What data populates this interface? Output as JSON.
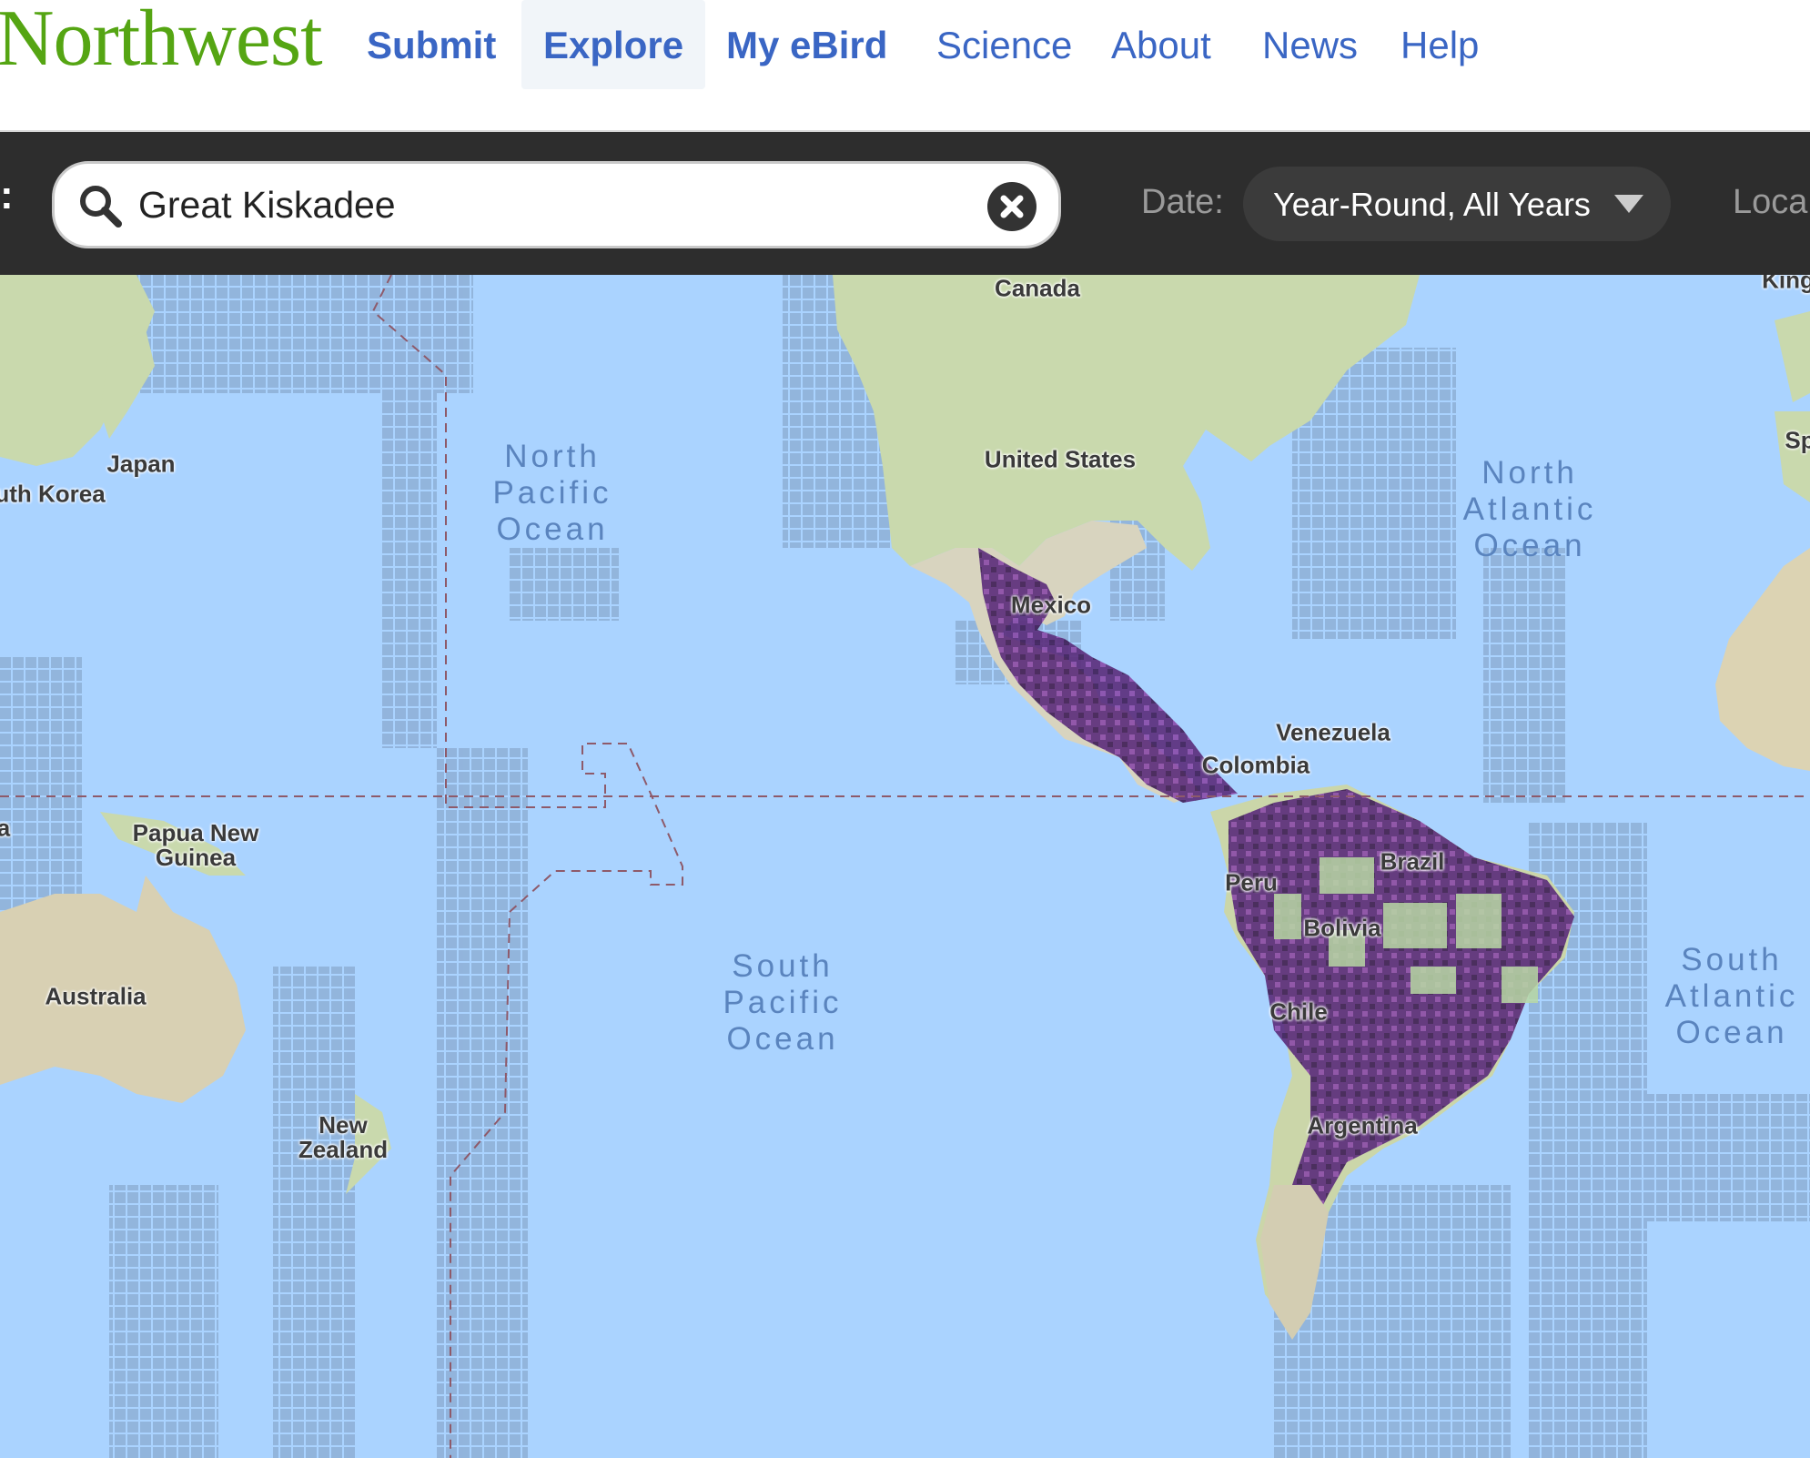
{
  "nav": {
    "brand": "Northwest",
    "links": [
      {
        "label": "Submit"
      },
      {
        "label": "Explore"
      },
      {
        "label": "My eBird"
      },
      {
        "label": "Science"
      },
      {
        "label": "About"
      },
      {
        "label": "News"
      },
      {
        "label": "Help"
      }
    ]
  },
  "filter": {
    "prefix": ":",
    "species_value": "Great Kiskadee",
    "date_label": "Date:",
    "date_value": "Year-Round, All Years",
    "location_label": "Loca"
  },
  "map": {
    "countries": {
      "canada": "Canada",
      "united_states": "United States",
      "mexico": "Mexico",
      "japan": "Japan",
      "south_korea": "uth Korea",
      "papua": "Papua New\nGuinea",
      "australia": "Australia",
      "new_zealand": "New\nZealand",
      "venezuela": "Venezuela",
      "colombia": "Colombia",
      "peru": "Peru",
      "brazil": "Brazil",
      "bolivia": "Bolivia",
      "chile": "Chile",
      "argentina": "Argentina",
      "kingdom_partial": "King",
      "spain_partial": "Sp",
      "edge_partial": "a"
    },
    "oceans": {
      "north_pacific": "North\nPacific\nOcean",
      "south_pacific": "South\nPacific\nOcean",
      "north_atlantic": "North\nAtlantic\nOcean",
      "south_atlantic": "South\nAtlantic\nOcean"
    },
    "colors": {
      "water": "#aad3ff",
      "land": "#cfdcb4",
      "survey_grid": "#8fa9c8",
      "range_dark": "#4b2466",
      "range_mid": "#7a3b95",
      "range_light": "#c27ce0"
    }
  }
}
